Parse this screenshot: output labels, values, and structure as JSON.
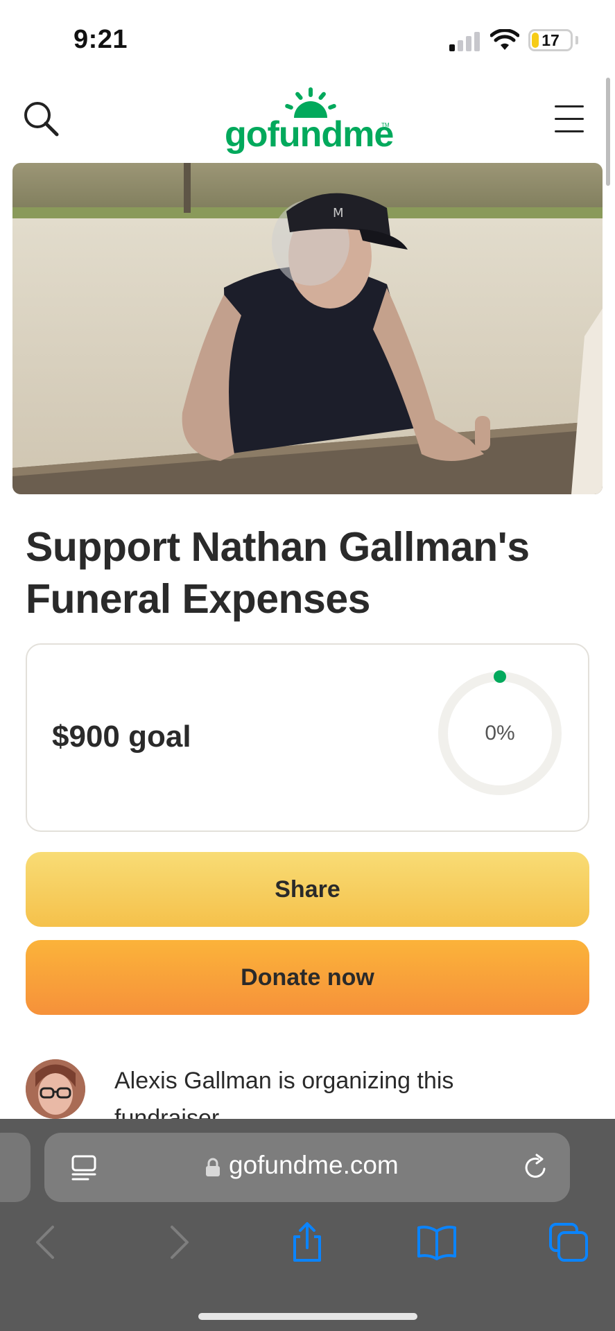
{
  "status_bar": {
    "time": "9:21",
    "battery_level": "17",
    "signal_bars_active": 1,
    "signal_bars_total": 4
  },
  "header": {
    "logo_text": "gofundme",
    "logo_tm": "TM",
    "icons": {
      "left": "search-icon",
      "right": "hamburger-menu-icon"
    }
  },
  "hero": {
    "image": "fundraiser-photo"
  },
  "campaign": {
    "title": "Support Nathan Gallman's Funeral Expenses",
    "goal_label": "$900 goal",
    "progress_label": "0%",
    "progress_fraction": 0
  },
  "actions": {
    "share_label": "Share",
    "donate_label": "Donate now"
  },
  "organizer": {
    "text": "Alexis Gallman is organizing this fundraiser."
  },
  "browser": {
    "url": "gofundme.com",
    "icons": [
      "reader-icon",
      "lock-icon",
      "reload-icon",
      "back-icon",
      "forward-icon",
      "share-icon",
      "bookmarks-icon",
      "tabs-icon"
    ]
  },
  "colors": {
    "brand_green": "#02a95c",
    "share_yellow": "#f6c850",
    "donate_orange": "#f8a03a",
    "safari_bar": "#5a5a5a",
    "ios_blue": "#0a84ff"
  }
}
